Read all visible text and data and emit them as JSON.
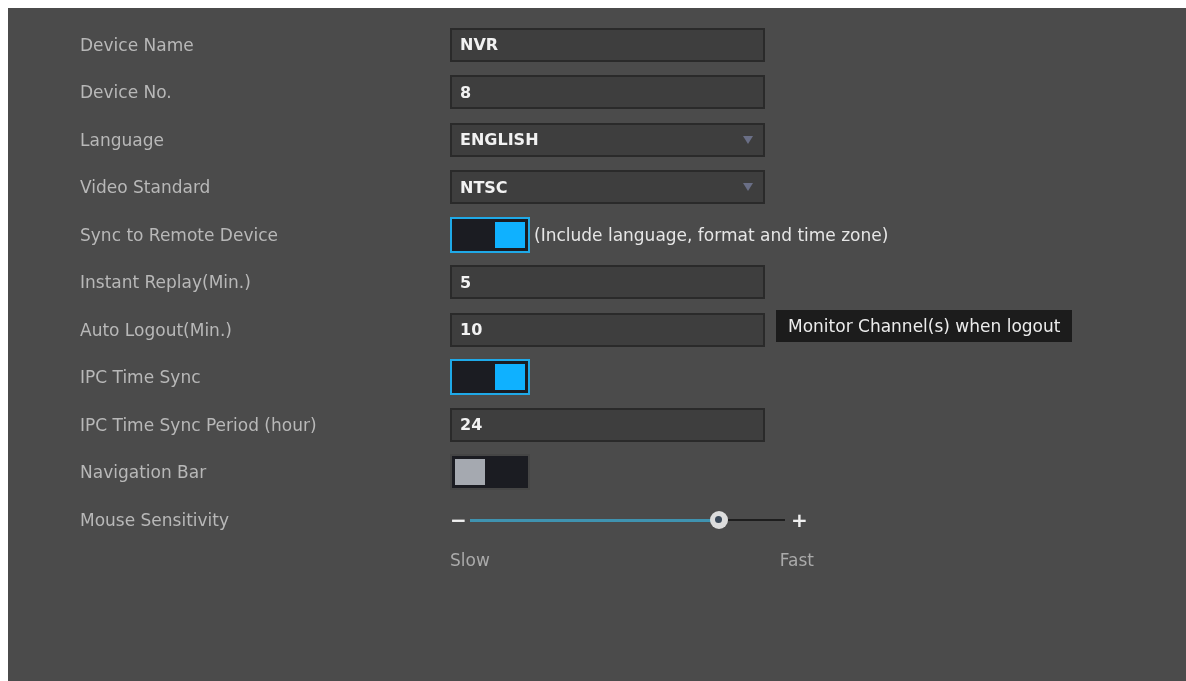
{
  "settings": [
    {
      "kind": "text",
      "label": "Device Name",
      "value": "NVR"
    },
    {
      "kind": "text",
      "label": "Device No.",
      "value": "8"
    },
    {
      "kind": "dropdown",
      "label": "Language",
      "value": "ENGLISH"
    },
    {
      "kind": "dropdown",
      "label": "Video Standard",
      "value": "NTSC"
    },
    {
      "kind": "toggle",
      "label": "Sync to Remote Device",
      "on": true,
      "note": "(Include language, format and time zone)"
    },
    {
      "kind": "text",
      "label": "Instant Replay(Min.)",
      "value": "5"
    },
    {
      "kind": "text",
      "label": "Auto Logout(Min.)",
      "value": "10",
      "tooltip": "Monitor Channel(s) when logout"
    },
    {
      "kind": "toggle",
      "label": "IPC Time Sync",
      "on": true
    },
    {
      "kind": "text",
      "label": "IPC Time Sync Period (hour)",
      "value": "24"
    },
    {
      "kind": "toggle",
      "label": "Navigation Bar",
      "on": false
    },
    {
      "kind": "slider",
      "label": "Mouse Sensitivity",
      "level": 0.79,
      "minus": "−",
      "plus": "+",
      "min_label": "Slow",
      "max_label": "Fast"
    }
  ]
}
